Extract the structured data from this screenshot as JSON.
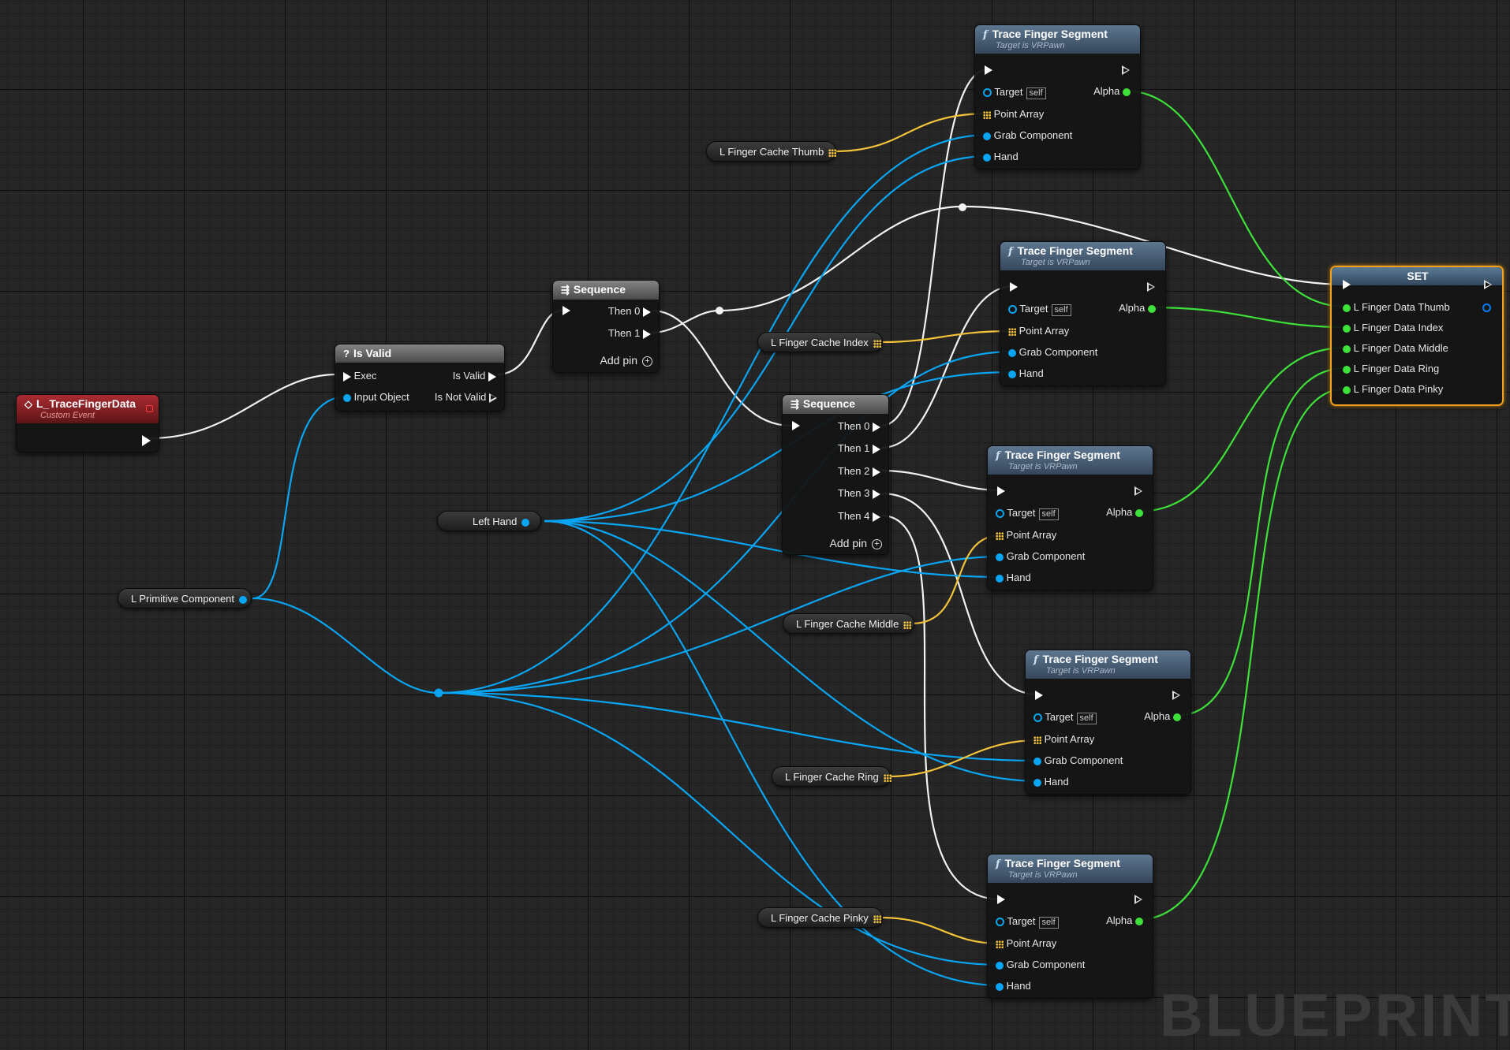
{
  "event_node": {
    "title": "L_TraceFingerData",
    "subtitle": "Custom Event"
  },
  "is_valid_node": {
    "title": "Is Valid",
    "exec": "Exec",
    "input_object": "Input Object",
    "is_valid": "Is Valid",
    "is_not_valid": "Is Not Valid"
  },
  "sequence_1": {
    "title": "Sequence",
    "then0": "Then 0",
    "then1": "Then 1",
    "add_pin": "Add pin"
  },
  "sequence_2": {
    "title": "Sequence",
    "then0": "Then 0",
    "then1": "Then 1",
    "then2": "Then 2",
    "then3": "Then 3",
    "then4": "Then 4",
    "add_pin": "Add pin"
  },
  "trace_nodes": [
    {
      "title": "Trace Finger Segment",
      "subtitle": "Target is VRPawn",
      "target": "Target",
      "self": "self",
      "alpha": "Alpha",
      "point_array": "Point Array",
      "grab_component": "Grab Component",
      "hand": "Hand"
    },
    {
      "title": "Trace Finger Segment",
      "subtitle": "Target is VRPawn",
      "target": "Target",
      "self": "self",
      "alpha": "Alpha",
      "point_array": "Point Array",
      "grab_component": "Grab Component",
      "hand": "Hand"
    },
    {
      "title": "Trace Finger Segment",
      "subtitle": "Target is VRPawn",
      "target": "Target",
      "self": "self",
      "alpha": "Alpha",
      "point_array": "Point Array",
      "grab_component": "Grab Component",
      "hand": "Hand"
    },
    {
      "title": "Trace Finger Segment",
      "subtitle": "Target is VRPawn",
      "target": "Target",
      "self": "self",
      "alpha": "Alpha",
      "point_array": "Point Array",
      "grab_component": "Grab Component",
      "hand": "Hand"
    },
    {
      "title": "Trace Finger Segment",
      "subtitle": "Target is VRPawn",
      "target": "Target",
      "self": "self",
      "alpha": "Alpha",
      "point_array": "Point Array",
      "grab_component": "Grab Component",
      "hand": "Hand"
    }
  ],
  "set_node": {
    "title": "SET",
    "pins": [
      "L Finger Data Thumb",
      "L Finger Data Index",
      "L Finger Data Middle",
      "L Finger Data Ring",
      "L Finger Data Pinky"
    ]
  },
  "variables": {
    "thumb": "L Finger Cache Thumb",
    "index": "L Finger Cache Index",
    "middle": "L Finger Cache Middle",
    "ring": "L Finger Cache Ring",
    "pinky": "L Finger Cache Pinky",
    "left_hand": "Left Hand",
    "primitive": "L Primitive Component"
  },
  "watermark": "BLUEPRINT",
  "colors": {
    "exec": "#ffffff",
    "object": "#0aa5f2",
    "float": "#3ee03a",
    "array": "#f2c23a",
    "event": "#a92b31",
    "selection": "#f2a11f"
  }
}
